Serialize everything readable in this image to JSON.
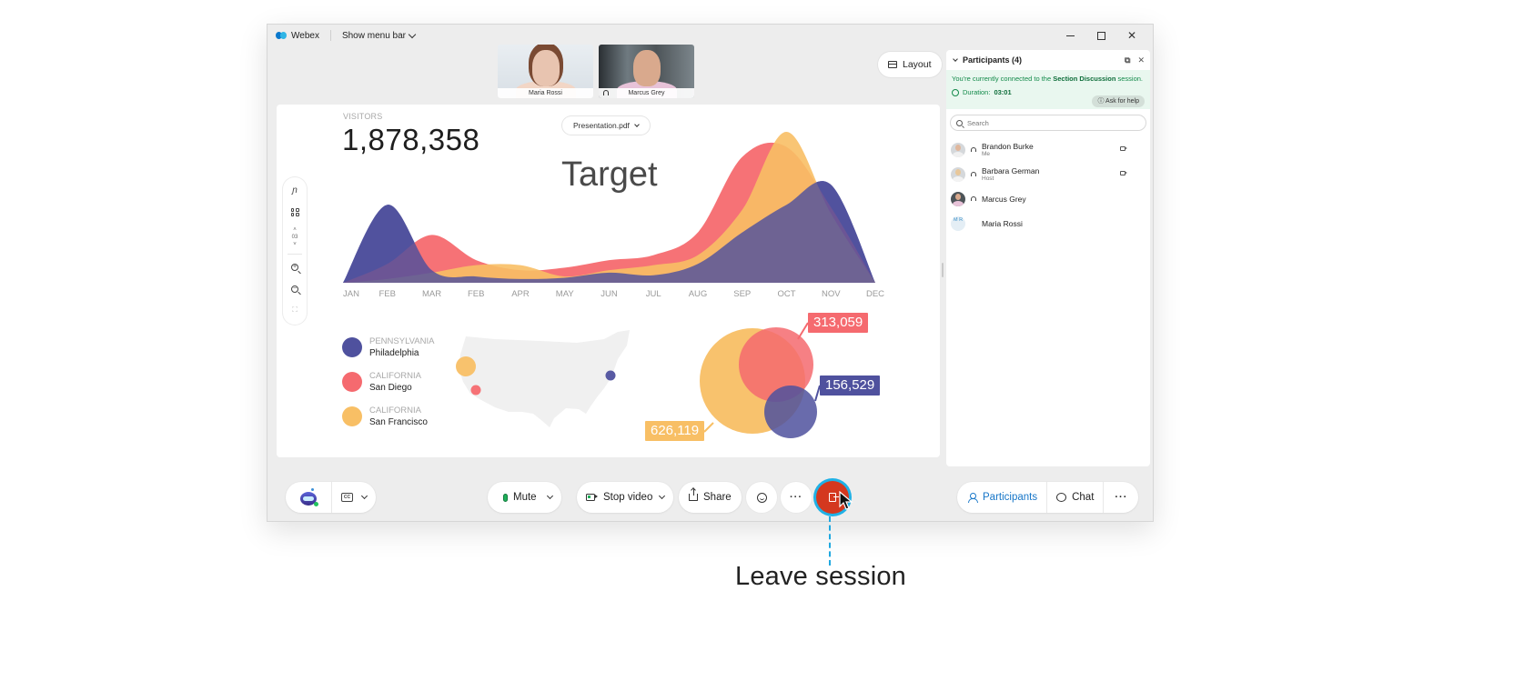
{
  "window": {
    "app_name": "Webex",
    "menu_toggle_label": "Show menu bar",
    "controls": [
      "minimize",
      "maximize",
      "close"
    ]
  },
  "video_thumbnails": [
    {
      "name": "Maria Rossi",
      "muted_icon": false
    },
    {
      "name": "Marcus Grey",
      "muted_icon": true
    }
  ],
  "layout_button": {
    "label": "Layout",
    "icon": "layout-icon"
  },
  "presentation": {
    "file_select": "Presentation.pdf",
    "visitors_label": "VISITORS",
    "visitors_value": "1,878,358",
    "slide_title": "Target",
    "page_number": "03",
    "tools": [
      "annotate-icon",
      "thumbnails-icon",
      "page-up-icon",
      "page-down-icon",
      "zoom-in-icon",
      "zoom-out-icon",
      "fullscreen-icon"
    ]
  },
  "chart_data": [
    {
      "type": "area",
      "title": "Target",
      "categories": [
        "JAN",
        "FEB",
        "MAR",
        "FEB",
        "APR",
        "MAY",
        "JUN",
        "JUL",
        "AUG",
        "SEP",
        "OCT",
        "NOV",
        "DEC"
      ],
      "series": [
        {
          "name": "Philadelphia",
          "color": "#4f519e",
          "values": [
            0,
            62,
            10,
            5,
            3,
            4,
            8,
            6,
            15,
            40,
            62,
            78,
            0
          ]
        },
        {
          "name": "San Diego",
          "color": "#f56a6f",
          "values": [
            0,
            15,
            38,
            18,
            10,
            12,
            18,
            22,
            40,
            100,
            108,
            60,
            0
          ]
        },
        {
          "name": "San Francisco",
          "color": "#f8bf65",
          "values": [
            0,
            3,
            8,
            14,
            14,
            5,
            10,
            14,
            22,
            58,
            120,
            55,
            0
          ]
        }
      ],
      "ylim": [
        0,
        120
      ],
      "grid": false,
      "legend": "none"
    },
    {
      "type": "bubble",
      "series": [
        {
          "state": "PENNSYLVANIA",
          "city": "Philadelphia",
          "value": 156529,
          "label": "156,529",
          "color": "#4f519e"
        },
        {
          "state": "CALIFORNIA",
          "city": "San Diego",
          "value": 313059,
          "label": "313,059",
          "color": "#f56a6f"
        },
        {
          "state": "CALIFORNIA",
          "city": "San Francisco",
          "value": 626119,
          "label": "626,119",
          "color": "#f8bf65"
        }
      ]
    }
  ],
  "participants_panel": {
    "title": "Participants (4)",
    "session_message_prefix": "You're currently connected to the ",
    "session_name": "Section Discussion",
    "session_message_suffix": " session.",
    "duration_label": "Duration:",
    "duration_value": "03:01",
    "help_button": "Ask for help",
    "search_placeholder": "Search",
    "participants": [
      {
        "name": "Brandon Burke",
        "role": "Me",
        "headset": true,
        "camera": true,
        "avatar": "photo"
      },
      {
        "name": "Barbara German",
        "role": "Host",
        "headset": true,
        "camera": true,
        "avatar": "photo"
      },
      {
        "name": "Marcus Grey",
        "role": "",
        "headset": true,
        "camera": false,
        "avatar": "photo"
      },
      {
        "name": "Maria Rossi",
        "role": "",
        "headset": false,
        "camera": false,
        "avatar": "initials",
        "initials": "M R"
      }
    ]
  },
  "controls": {
    "mute": "Mute",
    "stop_video": "Stop video",
    "share": "Share",
    "reactions_icon": "emoji-icon",
    "more_icon": "more-icon",
    "leave_icon": "leave-icon",
    "participants": "Participants",
    "chat": "Chat",
    "captions_icon": "closed-captions-icon",
    "assistant_icon": "ai-assistant-icon",
    "cc_text": "CC"
  },
  "callout": {
    "label": "Leave session",
    "color": "#1fa8e0"
  },
  "colors": {
    "accent_blue": "#1776c8",
    "leave_red": "#d4381f",
    "focus_ring": "#1fb1e6",
    "session_green": "#138a4a"
  }
}
